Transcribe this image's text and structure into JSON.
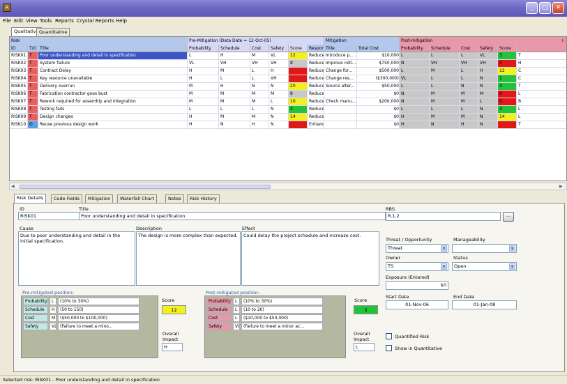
{
  "window": {
    "app_icon_glyph": "R",
    "min": "_",
    "max": "□",
    "close": "✕"
  },
  "menu": [
    "File",
    "Edit",
    "View",
    "Tools",
    "Reports",
    "Crystal Reports",
    "Help"
  ],
  "top_tabs": [
    "Qualitative",
    "Quantitative"
  ],
  "grid": {
    "group_headers": {
      "risk": "Risk",
      "pre": "Pre-Mitigation (Data Date = 12-Oct-05)",
      "mit": "Mitigation",
      "post": "Post-mitigation",
      "extra": "I"
    },
    "columns": [
      "ID",
      "T/O",
      "Title",
      "Probability",
      "Schedule",
      "Cost",
      "Safety",
      "Score",
      "Response",
      "Title",
      "Total Cost",
      "Probability",
      "Schedule",
      "Cost",
      "Safety",
      "Score",
      ""
    ],
    "rows": [
      [
        "RISK01",
        "T",
        "Poor understanding and detail in specification",
        "L",
        "H",
        "M",
        "VL",
        "12",
        "Reduce",
        "Introduce p...",
        "$10,000",
        "L",
        "L",
        "L",
        "VL",
        "3",
        "T"
      ],
      [
        "RISK02",
        "T",
        "System failure",
        "VL",
        "VH",
        "VH",
        "VH",
        "8",
        "Reduce",
        "Improve initi...",
        "$750,000",
        "N",
        "VH",
        "VH",
        "VH",
        "0",
        "H"
      ],
      [
        "RISK03",
        "T",
        "Contract Delay",
        "H",
        "M",
        "L",
        "H",
        "",
        "Reduce",
        "Change for...",
        "$500,000",
        "L",
        "M",
        "L",
        "H",
        "12",
        "C"
      ],
      [
        "RISK04",
        "T",
        "Key resource unavailable",
        "H",
        "L",
        "L",
        "VH",
        "",
        "Reduce",
        "Change res...",
        "($300,000)",
        "VL",
        "L",
        "L",
        "N",
        "1",
        "C"
      ],
      [
        "RISK05",
        "T",
        "Delivery overrun",
        "M",
        "H",
        "N",
        "N",
        "20",
        "Reduce",
        "Source alter...",
        "$50,000",
        "L",
        "L",
        "N",
        "N",
        "3",
        "T"
      ],
      [
        "RISK06",
        "T",
        "Fabrication contractor goes bust",
        "M",
        "M",
        "M",
        "M",
        "8",
        "Reduce",
        "",
        "$0",
        "N",
        "M",
        "M",
        "M",
        "0",
        "L"
      ],
      [
        "RISK07",
        "T",
        "Rework required for assembly and integration",
        "M",
        "M",
        "M",
        "L",
        "10",
        "Reduce",
        "Check manu...",
        "$200,000",
        "N",
        "M",
        "M",
        "L",
        "0",
        "B"
      ],
      [
        "RISK08",
        "T",
        "Testing fails",
        "L",
        "L",
        "L",
        "N",
        "3",
        "Reduce",
        "",
        "$0",
        "L",
        "L",
        "L",
        "N",
        "3",
        "L"
      ],
      [
        "RISK09",
        "T",
        "Design changes",
        "H",
        "M",
        "M",
        "N",
        "14",
        "Reduce",
        "",
        "$0",
        "H",
        "M",
        "M",
        "N",
        "14",
        "L"
      ],
      [
        "RISK10",
        "O",
        "Reuse previous design work",
        "H",
        "N",
        "H",
        "N",
        "",
        "Enhance",
        "",
        "$0",
        "H",
        "N",
        "H",
        "N",
        "",
        "T"
      ]
    ]
  },
  "bottom_tabs": [
    "Risk Details",
    "Code Fields",
    "Mitigation",
    "Waterfall Chart",
    "Notes",
    "Risk History"
  ],
  "details": {
    "id_label": "ID",
    "id_value": "RISK01",
    "title_label": "Title",
    "title_value": "Poor understanding and detail in specification",
    "rbs_label": "RBS",
    "rbs_value": "R.1.2",
    "rbs_btn": "...",
    "cause_label": "Cause",
    "cause_value": "Due to poor understanding and detail in the initial specification.",
    "desc_label": "Description",
    "desc_value": "The design is more complex than expected.",
    "effect_label": "Effect",
    "effect_value": "Could delay the project schedule and increase cost.",
    "threat_label": "Threat / Opportunity",
    "threat_value": "Threat",
    "manage_label": "Manageability",
    "manage_value": "",
    "owner_label": "Owner",
    "owner_value": "TS",
    "status_label": "Status",
    "status_value": "Open",
    "exposure_label": "Exposure (Entered)",
    "exposure_value": "$0",
    "start_label": "Start Date",
    "start_value": "01-Nov-06",
    "end_label": "End Date",
    "end_value": "01-Jan-08",
    "quantified_label": "Quantified Risk",
    "show_quant_label": "Show in Quantitative",
    "pre_label": "Pre-mitigated position:",
    "post_label": "Post-mitigated position:",
    "score_label": "Score",
    "pre_score": "12",
    "post_score": "3",
    "impact_label": "Overall Impact",
    "pre_impact": "H",
    "post_impact": "L",
    "pre_rows": [
      [
        "Probability",
        "L",
        "(10% to 30%)"
      ],
      [
        "Schedule",
        "H",
        "(50 to 150)"
      ],
      [
        "Cost",
        "M",
        "($50,000 to $100,000)"
      ],
      [
        "Safety",
        "VL",
        "(Failure to meet a mino..."
      ]
    ],
    "post_rows": [
      [
        "Probability",
        "L",
        "(10% to 30%)"
      ],
      [
        "Schedule",
        "L",
        "(10 to 20)"
      ],
      [
        "Cost",
        "L",
        "($10,000 to $50,000)"
      ],
      [
        "Safety",
        "VL",
        "(Failure to meet a minor ac..."
      ]
    ]
  },
  "status_bar": "Selected risk: RISK01 - Poor understanding and detail in specification",
  "colors": {
    "red": "#e01818",
    "yellow": "#f2f01e",
    "green": "#22c23a",
    "pink": "#e898a8",
    "mit": "#b4c8ec",
    "pre": "#d6d8f6",
    "teal": "#c2e8e4",
    "grey": "#c8c8c8"
  }
}
